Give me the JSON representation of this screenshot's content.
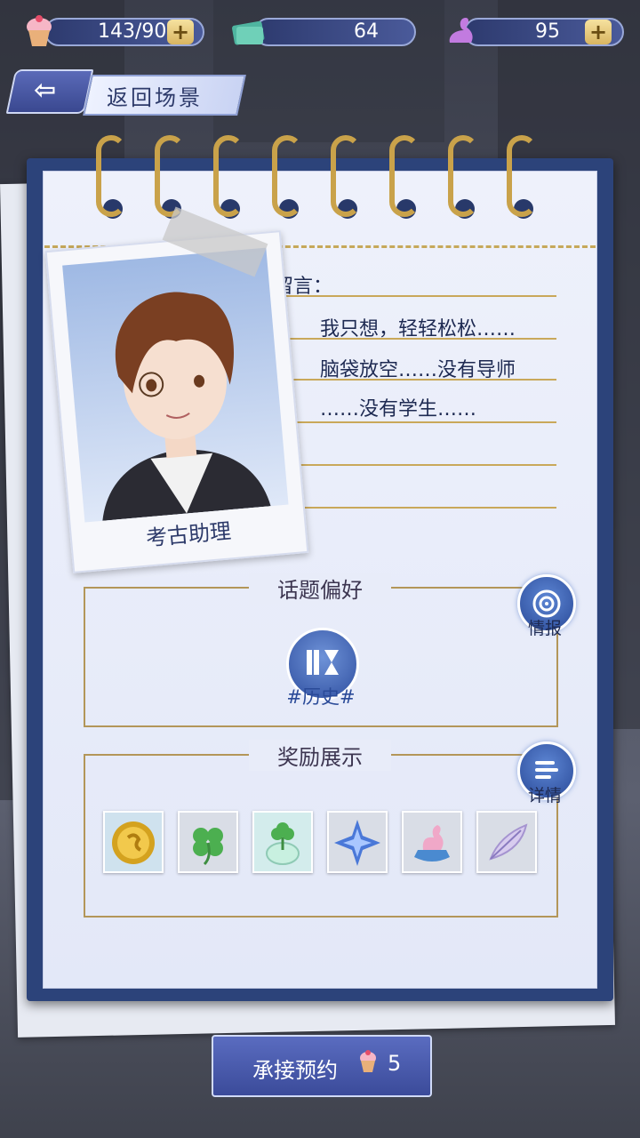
{
  "resources": [
    {
      "icon": "cupcake-icon",
      "value": "143/90",
      "has_plus": true
    },
    {
      "icon": "ticket-icon",
      "value": "64",
      "has_plus": false
    },
    {
      "icon": "swan-crystal-icon",
      "value": "95",
      "has_plus": true
    }
  ],
  "plus_symbol": "+",
  "back": {
    "arrow": "⇦",
    "label": "返回场景"
  },
  "character": {
    "name": "考古助理"
  },
  "message": {
    "title": "留言：",
    "lines": [
      "我只想，轻轻松松……",
      "脑袋放空……没有导师",
      "……没有学生……"
    ]
  },
  "topic": {
    "title": "话题偏好",
    "icon": "books-hourglass-icon",
    "tag": "#历史#",
    "intel_label": "情报",
    "intel_icon": "radar-icon"
  },
  "rewards": {
    "title": "奖励展示",
    "detail_label": "详情",
    "detail_icon": "list-icon",
    "items": [
      {
        "icon": "gold-coin-icon"
      },
      {
        "icon": "clover-icon"
      },
      {
        "icon": "clover-jar-icon"
      },
      {
        "icon": "blue-crystal-icon"
      },
      {
        "icon": "swan-figurine-icon"
      },
      {
        "icon": "feather-icon"
      }
    ]
  },
  "accept_button": {
    "label": "承接预约",
    "icon": "cupcake-icon",
    "cost": "5"
  }
}
